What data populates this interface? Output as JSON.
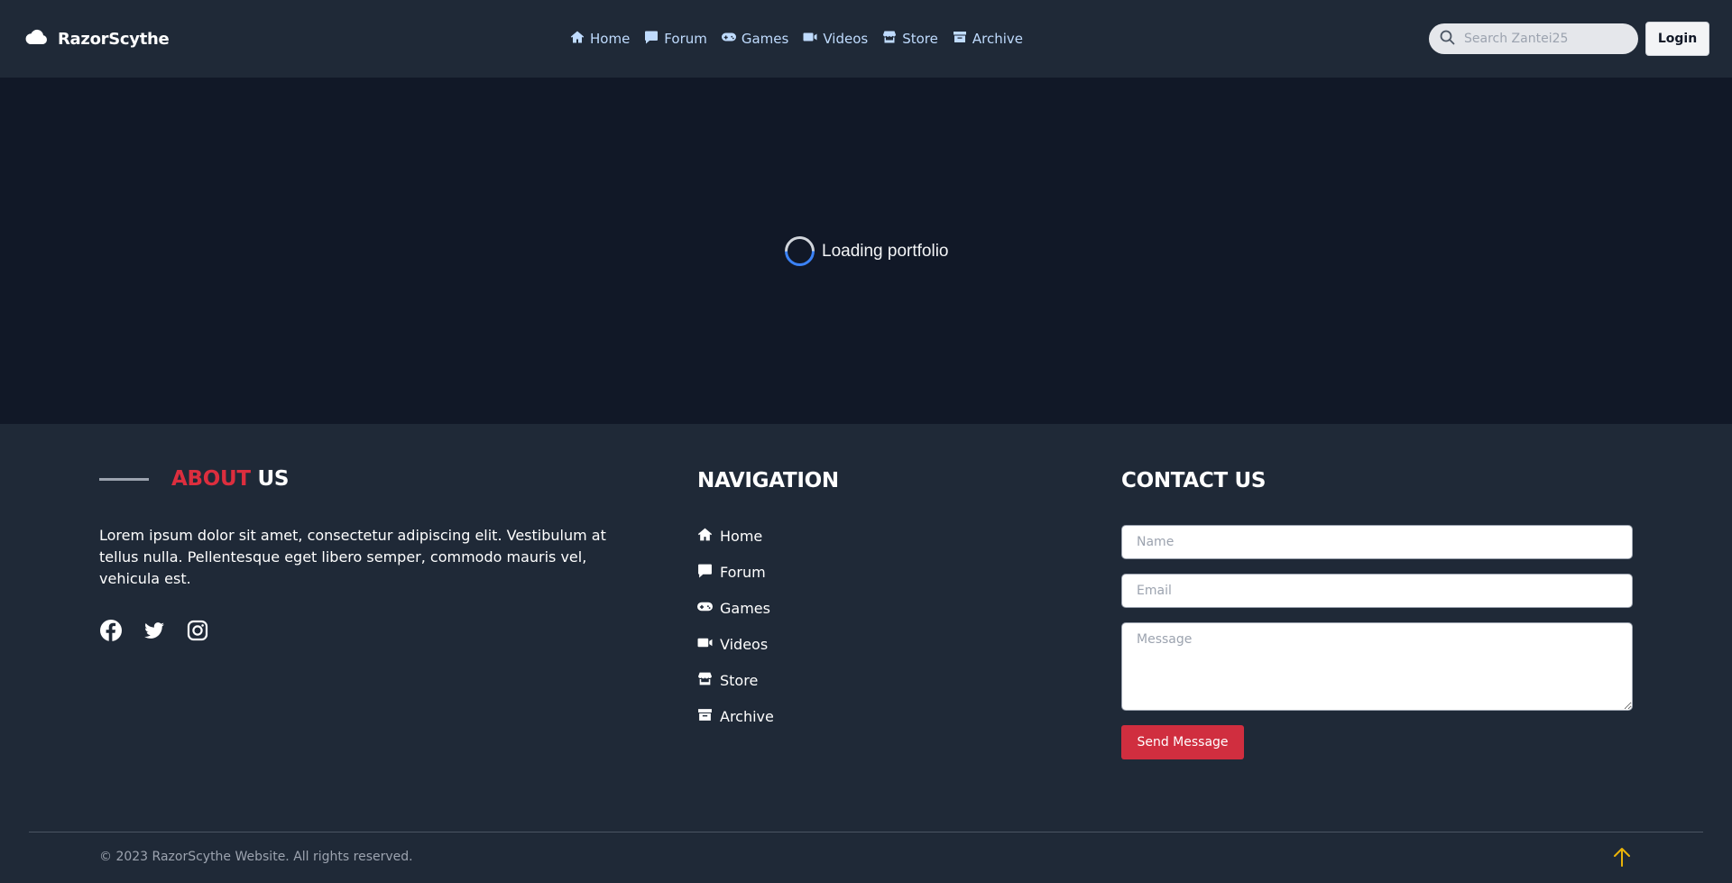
{
  "header": {
    "brand": "RazorScythe",
    "nav": [
      {
        "label": "Home",
        "icon": "home-icon"
      },
      {
        "label": "Forum",
        "icon": "comment-icon"
      },
      {
        "label": "Games",
        "icon": "gamepad-icon"
      },
      {
        "label": "Videos",
        "icon": "video-icon"
      },
      {
        "label": "Store",
        "icon": "store-icon"
      },
      {
        "label": "Archive",
        "icon": "archive-icon"
      }
    ],
    "search_placeholder": "Search Zantei25",
    "search_value": "",
    "login_label": "Login"
  },
  "main": {
    "loading_text": "Loading portfolio"
  },
  "footer": {
    "about": {
      "title_accent": "ABOUT",
      "title_rest": " US",
      "text": "Lorem ipsum dolor sit amet, consectetur adipiscing elit. Vestibulum at tellus nulla. Pellentesque eget libero semper, commodo mauris vel, vehicula est.",
      "socials": [
        "facebook-icon",
        "twitter-icon",
        "instagram-icon"
      ]
    },
    "navigation": {
      "title": "NAVIGATION",
      "items": [
        {
          "label": "Home",
          "icon": "home-icon"
        },
        {
          "label": "Forum",
          "icon": "comment-icon"
        },
        {
          "label": "Games",
          "icon": "gamepad-icon"
        },
        {
          "label": "Videos",
          "icon": "video-icon"
        },
        {
          "label": "Store",
          "icon": "store-icon"
        },
        {
          "label": "Archive",
          "icon": "archive-icon"
        }
      ]
    },
    "contact": {
      "title": "CONTACT US",
      "name_placeholder": "Name",
      "email_placeholder": "Email",
      "message_placeholder": "Message",
      "send_label": "Send Message"
    },
    "copyright": "© 2023 RazorScythe Website. All rights reserved."
  },
  "colors": {
    "header_bg": "#1f2937",
    "main_bg": "#111827",
    "accent_red": "#dc2e3e",
    "nav_link": "#bfdbfe",
    "back_to_top": "#eab308"
  }
}
